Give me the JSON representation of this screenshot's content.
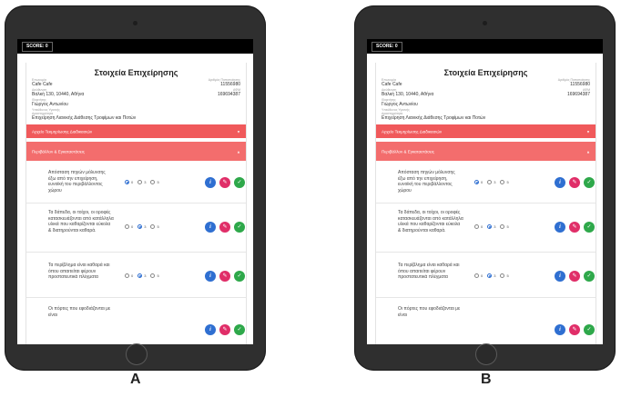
{
  "screen": {
    "score": "SCORE: 0",
    "title": "Στοιχεία Επιχείρησης",
    "business": {
      "name_label": "Επωνυμία",
      "name": "Cafe Cafe",
      "address_label": "Διεύθυνση",
      "address": "Βαλκή 130, 10440, Αθήνα",
      "owner_label": "Ιδιοκτήτης",
      "owner": "Γιώργος Αντωνίου",
      "manager_label": "Υπεύθυνος Υγιεινής",
      "activity_label": "Δραστηριότητα",
      "activity": "Επιχείρηση Λιανικής Διάθεσης Τροφίμων και Ποτών",
      "reg_label": "Αριθμός Πιστοποίησης",
      "reg": "11556980",
      "vat_label": "ΑΦΜ",
      "vat": "169694387"
    },
    "panels": [
      "Αρχείο Τεκμηρίωσης Διαδικασιών",
      "Περιβάλλον & Εγκαταστάσεις"
    ],
    "questions": [
      {
        "text": "Απόσταση πηγών μόλυνσης έξω από την επιχείρηση, ευνοϊκή του περιβάλλοντος χώρου"
      },
      {
        "text": "Τα δάπεδα, οι τοίχοι, οι οροφές κατασκευάζονται από κατάλληλα υλικά που καθαρίζονται εύκολα & διατηρούνται καθαρά."
      },
      {
        "text": "Τα περίβλημα είναι καθαρά και όπου απαιτείται φέρουν προστατευτικά πλέγματα"
      },
      {
        "text": "Οι πόρτες που εφοδιάζονται με είναι"
      }
    ],
    "radio_labels": [
      "0",
      "3",
      "5"
    ],
    "actions": {
      "info": "i",
      "edit": "✎",
      "ok": "✓"
    }
  },
  "tablet_a": {
    "label": "A",
    "selected": [
      0,
      1,
      1,
      1
    ]
  },
  "tablet_b": {
    "label": "B",
    "selected": [
      0,
      1,
      1,
      1
    ]
  }
}
